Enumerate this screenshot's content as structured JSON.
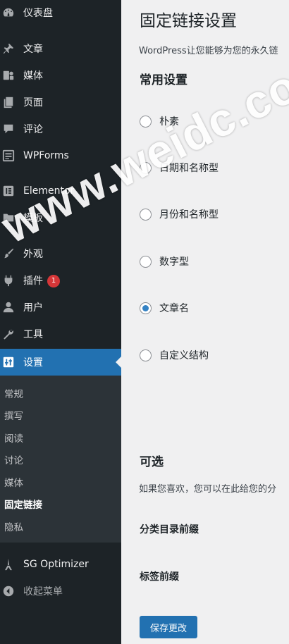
{
  "sidebar": {
    "items": [
      {
        "label": "仪表盘",
        "icon": "dashboard-icon"
      },
      {
        "label": "文章",
        "icon": "pin-icon"
      },
      {
        "label": "媒体",
        "icon": "media-icon"
      },
      {
        "label": "页面",
        "icon": "page-icon"
      },
      {
        "label": "评论",
        "icon": "comment-icon"
      },
      {
        "label": "WPForms",
        "icon": "forms-icon"
      },
      {
        "label": "Elementor",
        "icon": "elementor-icon"
      },
      {
        "label": "模板",
        "icon": "folder-icon"
      },
      {
        "label": "外观",
        "icon": "brush-icon"
      },
      {
        "label": "插件",
        "icon": "plugin-icon",
        "badge": "1"
      },
      {
        "label": "用户",
        "icon": "user-icon"
      },
      {
        "label": "工具",
        "icon": "wrench-icon"
      },
      {
        "label": "设置",
        "icon": "settings-icon",
        "active": true
      },
      {
        "label": "SG Optimizer",
        "icon": "sg-optimizer-icon"
      },
      {
        "label": "收起菜单",
        "icon": "collapse-icon"
      }
    ],
    "submenu": [
      "常规",
      "撰写",
      "阅读",
      "讨论",
      "媒体",
      "固定链接",
      "隐私"
    ],
    "submenu_current": "固定链接"
  },
  "main": {
    "title": "固定链接设置",
    "intro": "WordPress让您能够为您的永久链",
    "common_settings_title": "常用设置",
    "options": [
      {
        "label": "朴素",
        "checked": false
      },
      {
        "label": "日期和名称型",
        "checked": false
      },
      {
        "label": "月份和名称型",
        "checked": false
      },
      {
        "label": "数字型",
        "checked": false
      },
      {
        "label": "文章名",
        "checked": true
      },
      {
        "label": "自定义结构",
        "checked": false
      }
    ],
    "optional_title": "可选",
    "optional_desc": "如果您喜欢，您可以在此给您的分",
    "category_base_label": "分类目录前缀",
    "tag_base_label": "标签前缀",
    "save_label": "保存更改"
  },
  "watermark": "www.weidc.com",
  "colors": {
    "sidebar_bg": "#1d2327",
    "submenu_bg": "#2c3338",
    "accent": "#2271b1",
    "badge": "#d63638",
    "page_bg": "#f0f0f1"
  }
}
